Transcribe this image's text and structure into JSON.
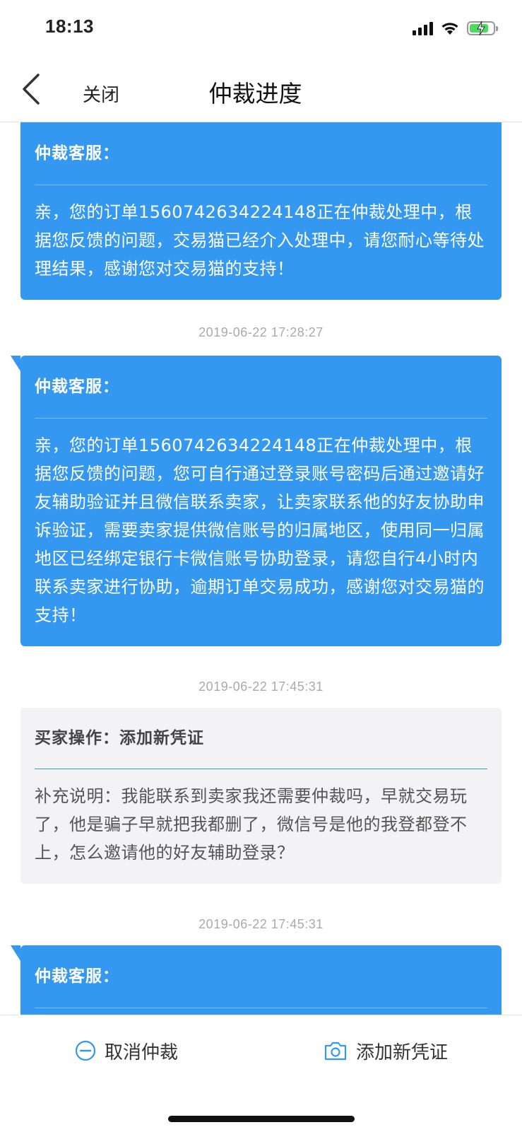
{
  "status_bar": {
    "time": "18:13",
    "battery_color": "#4cd964"
  },
  "nav": {
    "close_label": "关闭",
    "title": "仲裁进度"
  },
  "messages": [
    {
      "type": "agent",
      "sender": "仲裁客服：",
      "text": "亲，您的订单1560742634224148正在仲裁处理中，根据您反馈的问题，交易猫已经介入处理中，请您耐心等待处理结果，感谢您对交易猫的支持！"
    },
    {
      "timestamp": "2019-06-22 17:28:27"
    },
    {
      "type": "agent",
      "sender": "仲裁客服：",
      "text": "亲，您的订单1560742634224148正在仲裁处理中，根据您反馈的问题，您可自行通过登录账号密码后通过邀请好友辅助验证并且微信联系卖家，让卖家联系他的好友协助申诉验证，需要卖家提供微信账号的归属地区，使用同一归属地区已经绑定银行卡微信账号协助登录，请您自行4小时内联系卖家进行协助，逾期订单交易成功，感谢您对交易猫的支持！"
    },
    {
      "timestamp": "2019-06-22 17:45:31"
    },
    {
      "type": "buyer",
      "sender": "买家操作：添加新凭证",
      "text": "补充说明：我能联系到卖家我还需要仲裁吗，早就交易玩了，他是骗子早就把我都删了，微信号是他的我登都登不上，怎么邀请他的好友辅助登录？"
    },
    {
      "timestamp": "2019-06-22 17:45:31"
    },
    {
      "type": "agent",
      "sender": "仲裁客服：",
      "text": ""
    }
  ],
  "bottom": {
    "cancel_label": "取消仲裁",
    "cancel_icon": "minus-circle-icon",
    "add_label": "添加新凭证",
    "add_icon": "camera-icon"
  },
  "colors": {
    "accent": "#3598f0",
    "buyer_bg": "#f3f3f5",
    "timestamp": "#aaaaaa"
  }
}
